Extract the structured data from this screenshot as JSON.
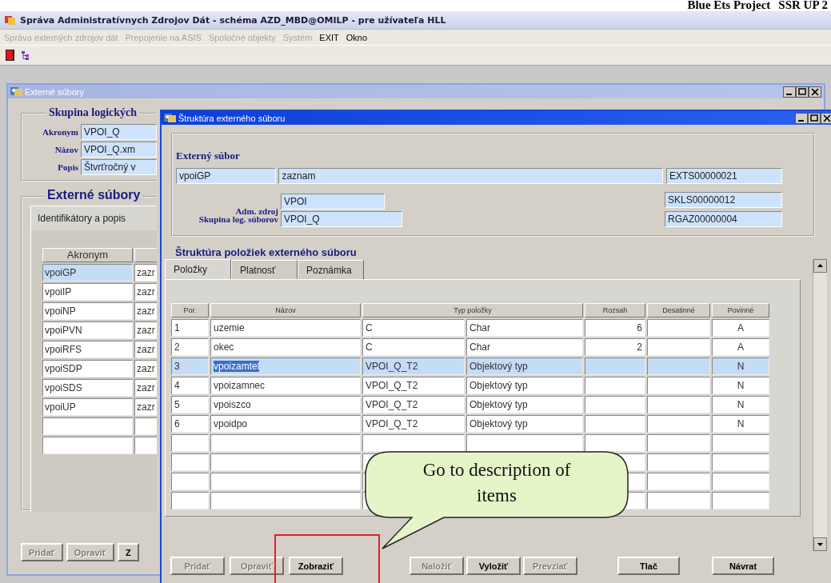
{
  "slide_header": {
    "title": "Blue Ets Project",
    "subtitle": "SSR UP 2"
  },
  "app": {
    "title": "Správa Administratívnych Zdrojov Dát - schéma AZD_MBD@OMILP - pre užívateľa HLL",
    "menu": [
      {
        "label": "Správa externých zdrojov dát",
        "disabled": true
      },
      {
        "label": "Prepojenie na ASIS",
        "disabled": true
      },
      {
        "label": "Spoločné objekty",
        "disabled": true
      },
      {
        "label": "Systém",
        "disabled": true
      },
      {
        "label": "EXIT",
        "disabled": false
      },
      {
        "label": "Okno",
        "disabled": false
      }
    ]
  },
  "files_window": {
    "title": "Externé súbory",
    "group_title": "Skupina logických",
    "fields": [
      {
        "label": "Akronym",
        "value": "VPOI_Q"
      },
      {
        "label": "Názov",
        "value": "VPOI_Q.xm"
      },
      {
        "label": "Popis",
        "value": "Štvrťročný v"
      }
    ],
    "section_title": "Externé súbory",
    "tab": "Identifikátory a popis",
    "column": "Akronym",
    "rows": [
      {
        "acronym": "vpoiGP",
        "column_2": "zazr",
        "selected": true
      },
      {
        "acronym": "vpoiIP",
        "column_2": "zazr",
        "selected": false
      },
      {
        "acronym": "vpoiNP",
        "column_2": "zazr",
        "selected": false
      },
      {
        "acronym": "vpoiPVN",
        "column_2": "zazr",
        "selected": false
      },
      {
        "acronym": "vpoiRFS",
        "column_2": "zazr",
        "selected": false
      },
      {
        "acronym": "vpoiSDP",
        "column_2": "zazr",
        "selected": false
      },
      {
        "acronym": "vpoiSDS",
        "column_2": "zazr",
        "selected": false
      },
      {
        "acronym": "vpoiUP",
        "column_2": "zazr",
        "selected": false
      }
    ],
    "buttons": [
      {
        "label": "Pridať",
        "disabled": true
      },
      {
        "label": "Opraviť",
        "disabled": true
      },
      {
        "label": "Z",
        "disabled": false
      }
    ]
  },
  "structure_window": {
    "title": "Štruktúra externého súboru",
    "group_title": "Externý súbor",
    "file_fields": [
      "vpoiGP",
      "zaznam",
      "EXTS00000021"
    ],
    "adm_label": "Adm. zdroj",
    "adm_value": "VPOI",
    "adm_code": "SKLS00000012",
    "group_label": "Skupina log. súborov",
    "group_value": "VPOI_Q",
    "group_code": "RGAZ00000004",
    "items_title": "Štruktúra položiek externého súboru",
    "tabs": [
      {
        "label": "Položky",
        "selected": true
      },
      {
        "label": "Platnosť",
        "selected": false
      },
      {
        "label": "Poznámka",
        "selected": false
      }
    ],
    "columns": [
      "Por.",
      "Názov",
      "Typ položky",
      "Rozsah",
      "Desatinné",
      "Povinné"
    ],
    "rows": [
      {
        "por": "1",
        "name": "uzemie",
        "type_code": "C",
        "type_name": "Char",
        "range": "6",
        "required": "A",
        "selected": false
      },
      {
        "por": "2",
        "name": "okec",
        "type_code": "C",
        "type_name": "Char",
        "range": "2",
        "required": "A",
        "selected": false
      },
      {
        "por": "3",
        "name": "vpoizamtel",
        "type_code": "VPOI_Q_T2",
        "type_name": "Objektový typ",
        "required": "N",
        "selected": true
      },
      {
        "por": "4",
        "name": "vpoizamnec",
        "type_code": "VPOI_Q_T2",
        "type_name": "Objektový typ",
        "required": "N",
        "selected": false
      },
      {
        "por": "5",
        "name": "vpoiszco",
        "type_code": "VPOI_Q_T2",
        "type_name": "Objektový typ",
        "required": "N",
        "selected": false
      },
      {
        "por": "6",
        "name": "vpoidpo",
        "type_code": "VPOI_Q_T2",
        "type_name": "Objektový typ",
        "required": "N",
        "selected": false
      }
    ],
    "buttons": [
      {
        "label": "Pridať",
        "disabled": true
      },
      {
        "label": "Opraviť",
        "disabled": true
      },
      {
        "label": "Zobraziť",
        "disabled": false
      },
      {
        "label": "Naložiť",
        "disabled": true
      },
      {
        "label": "Vyložiť",
        "disabled": false
      },
      {
        "label": "Prevziať",
        "disabled": true
      },
      {
        "label": "Tlač",
        "disabled": false
      },
      {
        "label": "Návrat",
        "disabled": false
      }
    ]
  },
  "callout": {
    "text": "Go to description of items"
  }
}
